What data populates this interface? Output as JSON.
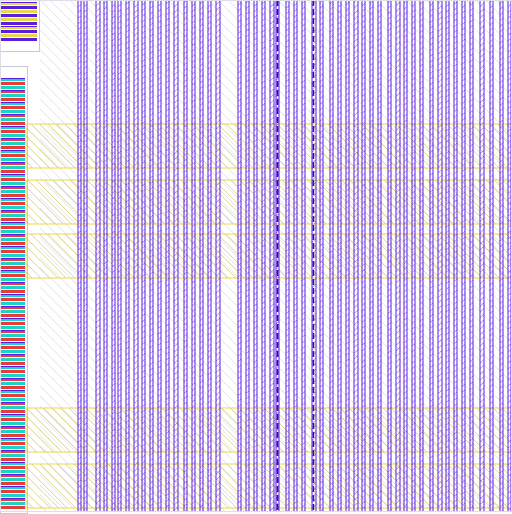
{
  "layers": {
    "metal": {
      "color": "#5a1ee0",
      "hatch": "#8b5cf6"
    },
    "poly": {
      "color": "#e8d848",
      "hatch": "#c8b838"
    },
    "diff": {
      "color": "#e83c3c"
    },
    "cell_fill": [
      "#1ad4c8",
      "#e8d848",
      "#3cd84c",
      "#e83c3c",
      "#5a1ee0",
      "#ffffff"
    ]
  },
  "view": {
    "icons": [
      "hatched-metal-rail",
      "hatched-poly-band",
      "standard-cell-strip"
    ]
  }
}
